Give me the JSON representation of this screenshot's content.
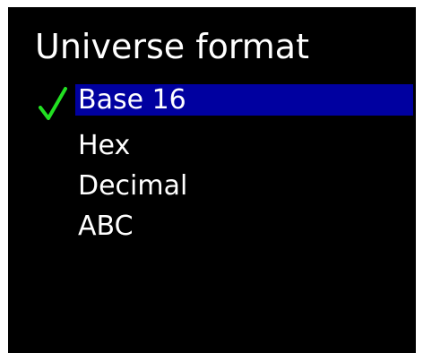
{
  "screen": {
    "title": "Universe format",
    "background": "#000000",
    "highlight_color": "#0000a0",
    "check_color": "#22e022"
  },
  "menu": {
    "items": [
      {
        "label": "Base 16",
        "selected": true,
        "checked": true
      },
      {
        "label": "Hex",
        "selected": false,
        "checked": false
      },
      {
        "label": "Decimal",
        "selected": false,
        "checked": false
      },
      {
        "label": "ABC",
        "selected": false,
        "checked": false
      }
    ],
    "check_icon": "checkmark-icon"
  }
}
